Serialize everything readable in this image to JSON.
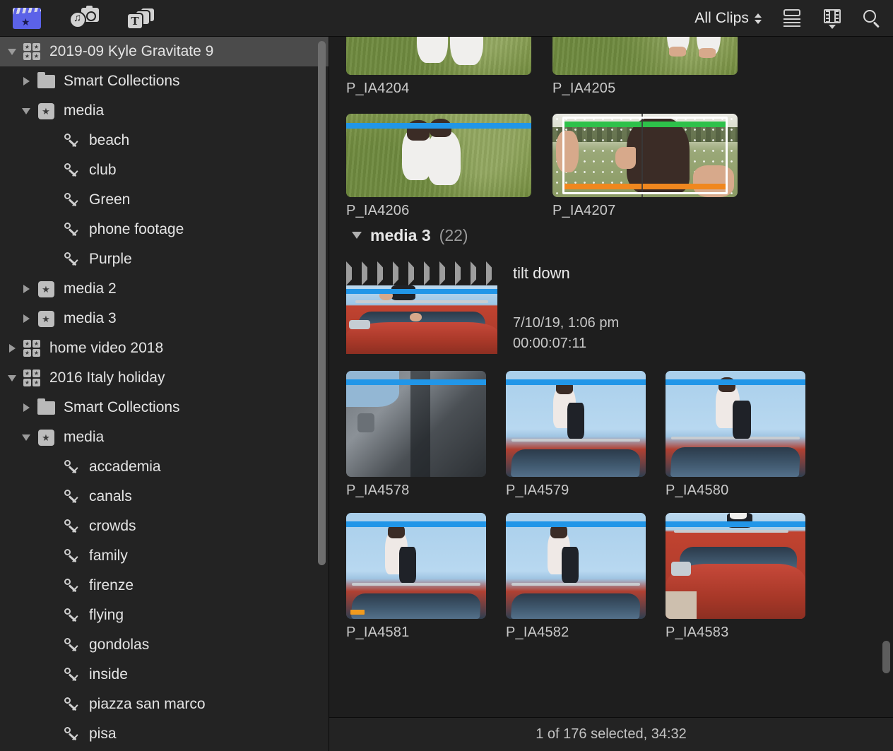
{
  "toolbar": {
    "icons": [
      {
        "name": "libraries-icon",
        "label": "Libraries"
      },
      {
        "name": "photos-audio-icon",
        "label": "Photos and Audio"
      },
      {
        "name": "titles-generators-icon",
        "label": "Titles and Generators"
      }
    ],
    "filter_label": "All Clips",
    "view_list_label": "List View",
    "view_filmstrip_label": "Filmstrip View",
    "search_label": "Search"
  },
  "sidebar": {
    "items": [
      {
        "label": "2019-09 Kyle Gravitate 9",
        "icon": "library-icon",
        "indent": 0,
        "disclosure": "open",
        "selected": true
      },
      {
        "label": "Smart Collections",
        "icon": "folder-icon",
        "indent": 1,
        "disclosure": "closed",
        "selected": false
      },
      {
        "label": "media",
        "icon": "event-icon",
        "indent": 1,
        "disclosure": "open",
        "selected": false
      },
      {
        "label": "beach",
        "icon": "keyword-icon",
        "indent": 2,
        "disclosure": "none",
        "selected": false
      },
      {
        "label": "club",
        "icon": "keyword-icon",
        "indent": 2,
        "disclosure": "none",
        "selected": false
      },
      {
        "label": "Green",
        "icon": "keyword-icon",
        "indent": 2,
        "disclosure": "none",
        "selected": false
      },
      {
        "label": "phone footage",
        "icon": "keyword-icon",
        "indent": 2,
        "disclosure": "none",
        "selected": false
      },
      {
        "label": "Purple",
        "icon": "keyword-icon",
        "indent": 2,
        "disclosure": "none",
        "selected": false
      },
      {
        "label": "media 2",
        "icon": "event-icon",
        "indent": 1,
        "disclosure": "closed",
        "selected": false
      },
      {
        "label": "media 3",
        "icon": "event-icon",
        "indent": 1,
        "disclosure": "closed",
        "selected": false
      },
      {
        "label": "home video 2018",
        "icon": "library-icon",
        "indent": 0,
        "disclosure": "closed",
        "selected": false
      },
      {
        "label": "2016 Italy holiday",
        "icon": "library-icon",
        "indent": 0,
        "disclosure": "open",
        "selected": false
      },
      {
        "label": "Smart Collections",
        "icon": "folder-icon",
        "indent": 1,
        "disclosure": "closed",
        "selected": false
      },
      {
        "label": "media",
        "icon": "event-icon",
        "indent": 1,
        "disclosure": "open",
        "selected": false
      },
      {
        "label": "accademia",
        "icon": "keyword-icon",
        "indent": 2,
        "disclosure": "none",
        "selected": false
      },
      {
        "label": "canals",
        "icon": "keyword-icon",
        "indent": 2,
        "disclosure": "none",
        "selected": false
      },
      {
        "label": "crowds",
        "icon": "keyword-icon",
        "indent": 2,
        "disclosure": "none",
        "selected": false
      },
      {
        "label": "family",
        "icon": "keyword-icon",
        "indent": 2,
        "disclosure": "none",
        "selected": false
      },
      {
        "label": "firenze",
        "icon": "keyword-icon",
        "indent": 2,
        "disclosure": "none",
        "selected": false
      },
      {
        "label": "flying",
        "icon": "keyword-icon",
        "indent": 2,
        "disclosure": "none",
        "selected": false
      },
      {
        "label": "gondolas",
        "icon": "keyword-icon",
        "indent": 2,
        "disclosure": "none",
        "selected": false
      },
      {
        "label": "inside",
        "icon": "keyword-icon",
        "indent": 2,
        "disclosure": "none",
        "selected": false
      },
      {
        "label": "piazza san marco",
        "icon": "keyword-icon",
        "indent": 2,
        "disclosure": "none",
        "selected": false
      },
      {
        "label": "pisa",
        "icon": "keyword-icon",
        "indent": 2,
        "disclosure": "none",
        "selected": false
      }
    ]
  },
  "browser": {
    "top_clips": [
      {
        "name": "P_IA4204",
        "scene": "grass-couple",
        "bar_top": null,
        "bar_bottom": null,
        "selected": false
      },
      {
        "name": "P_IA4205",
        "scene": "grass-two",
        "bar_top": null,
        "bar_bottom": null,
        "selected": false
      }
    ],
    "second_clips": [
      {
        "name": "P_IA4206",
        "scene": "grass-hug",
        "bar_top": "#2196e8",
        "bar_bottom": null,
        "selected": false
      },
      {
        "name": "P_IA4207",
        "scene": "rain-hair",
        "bar_top": "#2ec14a",
        "bar_bottom": "#f0871e",
        "selected": true
      }
    ],
    "group": {
      "name": "media 3",
      "count": "(22)",
      "disclosure": "open"
    },
    "featured_clip": {
      "title": "tilt down",
      "date": "7/10/19, 1:06 pm",
      "duration": "00:00:07:11",
      "bar_top": "#2196e8",
      "scene": "car-front"
    },
    "grid_rows": [
      [
        {
          "name": "P_IA4578",
          "scene": "interior",
          "bar_top": "#2196e8",
          "marker": false
        },
        {
          "name": "P_IA4579",
          "scene": "car-blue-a",
          "bar_top": "#2196e8",
          "marker": false
        },
        {
          "name": "P_IA4580",
          "scene": "car-blue-b",
          "bar_top": "#2196e8",
          "marker": false
        }
      ],
      [
        {
          "name": "P_IA4581",
          "scene": "car-blue-c",
          "bar_top": "#2196e8",
          "marker": true
        },
        {
          "name": "P_IA4582",
          "scene": "car-blue-d",
          "bar_top": "#2196e8",
          "marker": false
        },
        {
          "name": "P_IA4583",
          "scene": "car-front-b",
          "bar_top": "#2196e8",
          "marker": false
        }
      ]
    ]
  },
  "status": {
    "text": "1 of 176 selected, 34:32"
  },
  "colors": {
    "favorite_bar": "#2196e8",
    "keyword_bar": "#2ec14a",
    "marker_orange": "#f0871e",
    "selection": "#ffffff",
    "accent_blue": "#5b62e8"
  }
}
